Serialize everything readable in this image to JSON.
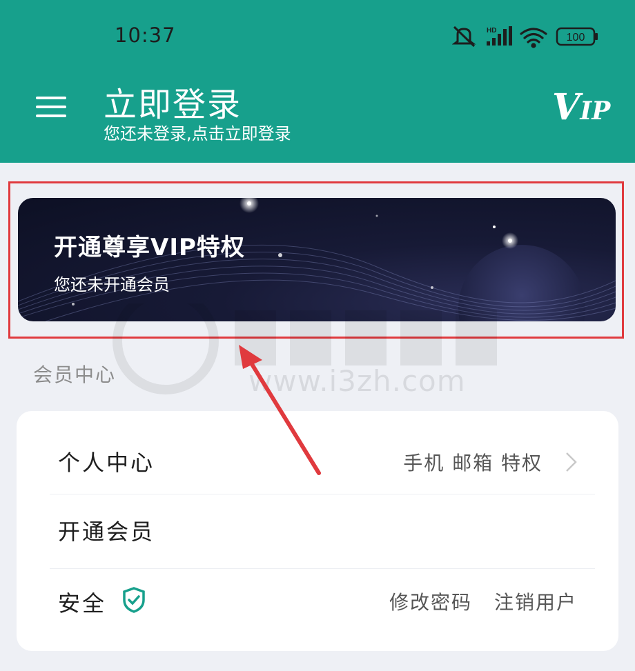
{
  "status_bar": {
    "time": "10:37",
    "battery": "100",
    "network": "HD"
  },
  "header": {
    "title": "立即登录",
    "subtitle": "您还未登录,点击立即登录",
    "vip_logo_v": "V",
    "vip_logo_ip": "IP"
  },
  "banner": {
    "title": "开通尊享VIP特权",
    "subtitle": "您还未开通会员"
  },
  "watermark": {
    "url": "www.i3zh.com"
  },
  "member_section": {
    "label": "会员中心",
    "rows": [
      {
        "label": "个人中心",
        "right": "手机 邮箱 特权"
      },
      {
        "label": "开通会员",
        "right": ""
      },
      {
        "label": "安全",
        "right_a": "修改密码",
        "right_b": "注销用户"
      }
    ]
  },
  "colors": {
    "header_bg": "#17a08c",
    "page_bg": "#eef0f5",
    "annotation_red": "#e03a3e",
    "shield_icon": "#17a08c"
  }
}
